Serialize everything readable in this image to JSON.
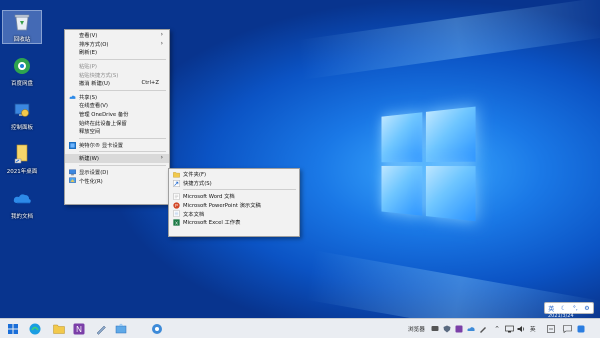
{
  "desktop": {
    "icons": [
      {
        "label": "回收站",
        "icon": "recycle-bin-icon"
      },
      {
        "label": "百度网盘",
        "icon": "baidu-disk-icon"
      },
      {
        "label": "控制面板",
        "icon": "control-panel-icon"
      },
      {
        "label": "2021年桌面",
        "icon": "folder-icon"
      },
      {
        "label": "我的文档",
        "icon": "onedrive-icon"
      }
    ]
  },
  "context_menu": {
    "items": [
      {
        "label": "查看(V)",
        "submenu": true
      },
      {
        "label": "排序方式(O)",
        "submenu": true
      },
      {
        "label": "刷新(E)"
      },
      {
        "label": "粘贴(P)",
        "disabled": true
      },
      {
        "label": "粘贴快捷方式(S)",
        "disabled": true
      },
      {
        "label": "撤消 新建(U)",
        "shortcut": "Ctrl+Z"
      },
      {
        "label": "共享(S)",
        "icon": "onedrive-icon"
      },
      {
        "label": "在线查看(V)"
      },
      {
        "label": "管理 OneDrive 备份"
      },
      {
        "label": "始终在此设备上保留"
      },
      {
        "label": "释放空间"
      },
      {
        "label": "英特尔® 显卡设置",
        "icon": "intel-graphics-icon"
      },
      {
        "label": "新建(W)",
        "submenu": true
      },
      {
        "label": "显示设置(D)",
        "icon": "display-settings-icon"
      },
      {
        "label": "个性化(R)",
        "icon": "personalize-icon"
      }
    ]
  },
  "new_submenu": {
    "items": [
      {
        "label": "文件夹(F)",
        "icon": "folder-icon"
      },
      {
        "label": "快捷方式(S)",
        "icon": "shortcut-icon"
      },
      {
        "label": "Microsoft Word 文档",
        "icon": "word-doc-icon"
      },
      {
        "label": "Microsoft PowerPoint 演示文稿",
        "icon": "powerpoint-icon"
      },
      {
        "label": "文本文档",
        "icon": "text-document-icon"
      },
      {
        "label": "Microsoft Excel 工作表",
        "icon": "excel-icon"
      }
    ]
  },
  "ime_bar": {
    "lang": "英"
  },
  "date_label": "2021/3/24",
  "taskbar": {
    "tray": {
      "browser_label": "浏览器",
      "ime": "英"
    }
  },
  "colors": {
    "accent": "#0a4fb8",
    "menu_bg": "#f2f2f2",
    "taskbar_bg": "#eaedf2"
  }
}
